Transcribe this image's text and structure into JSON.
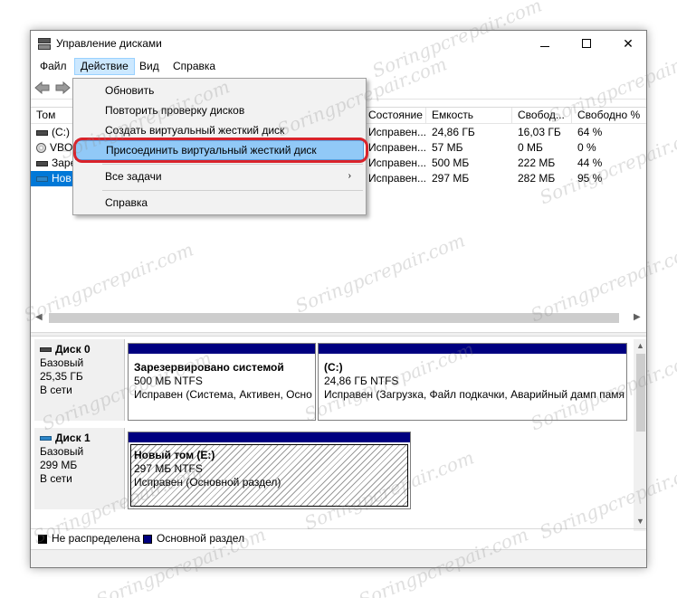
{
  "window": {
    "title": "Управление дисками",
    "controls": {
      "minimize": "—",
      "maximize": "□",
      "close": "✕"
    }
  },
  "menubar": {
    "items": [
      {
        "label": "Файл"
      },
      {
        "label": "Действие",
        "active": true
      },
      {
        "label": "Вид"
      },
      {
        "label": "Справка"
      }
    ]
  },
  "volume_table": {
    "columns": [
      "Том",
      "Состояние",
      "Емкость",
      "Свобод...",
      "Свободно %"
    ],
    "rows": [
      {
        "name": "(C:)",
        "icon": "volume-icon",
        "state": "Исправен...",
        "capacity": "24,86 ГБ",
        "free": "16,03 ГБ",
        "free_pct": "64 %"
      },
      {
        "name": "VBOX",
        "icon": "cd-icon",
        "state": "Исправен...",
        "capacity": "57 МБ",
        "free": "0 МБ",
        "free_pct": "0 %"
      },
      {
        "name": "Заре",
        "icon": "volume-icon",
        "state": "Исправен...",
        "capacity": "500 МБ",
        "free": "222 МБ",
        "free_pct": "44 %"
      },
      {
        "name": "Нов",
        "icon": "volume-icon-blue",
        "state": "Исправен...",
        "capacity": "297 МБ",
        "free": "282 МБ",
        "free_pct": "95 %",
        "selected": true
      }
    ]
  },
  "context_menu": {
    "items": [
      {
        "label": "Обновить"
      },
      {
        "label": "Повторить проверку дисков"
      },
      {
        "label": "Создать виртуальный жесткий диск"
      },
      {
        "label": "Присоединить виртуальный жесткий диск",
        "highlighted": true
      },
      {
        "label": "Все задачи",
        "submenu": "›"
      },
      {
        "label": "Справка"
      }
    ],
    "highlight_color": "#d9232b"
  },
  "disks": [
    {
      "name": "Диск 0",
      "type": "Базовый",
      "size": "25,35 ГБ",
      "status": "В сети",
      "partitions": [
        {
          "name": "Зарезервировано системой",
          "size_fs": "500 МБ NTFS",
          "status": "Исправен (Система, Активен, Осно"
        },
        {
          "name": "(C:)",
          "size_fs": "24,86 ГБ NTFS",
          "status": "Исправен (Загрузка, Файл подкачки, Аварийный дамп памя"
        }
      ]
    },
    {
      "name": "Диск 1",
      "type": "Базовый",
      "size": "299 МБ",
      "status": "В сети",
      "partitions": [
        {
          "name": "Новый том  (E:)",
          "size_fs": "297 МБ NTFS",
          "status": "Исправен (Основной раздел)"
        }
      ]
    }
  ],
  "legend": [
    {
      "label": "Не распределена",
      "color": "#000000"
    },
    {
      "label": "Основной раздел",
      "color": "#000080"
    }
  ],
  "watermark_text": "Soringpcrepair.com",
  "colors": {
    "partition_bar": "#000080",
    "selection": "#0078d7",
    "menu_active": "#cce8ff",
    "context_highlight": "#91c9f7"
  }
}
